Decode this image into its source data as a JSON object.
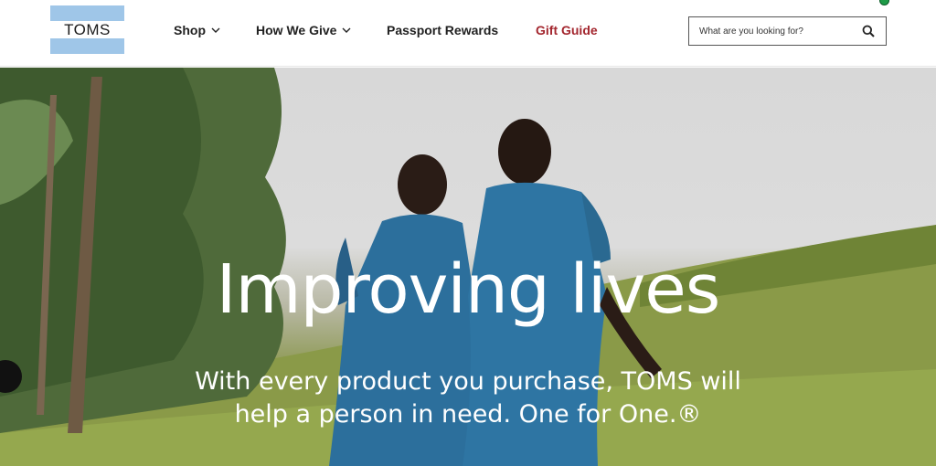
{
  "brand": {
    "logo_text": "TOMS"
  },
  "nav": {
    "shop": "Shop",
    "how_we_give": "How We Give",
    "passport_rewards": "Passport Rewards",
    "gift_guide": "Gift Guide"
  },
  "search": {
    "placeholder": "What are you looking for?"
  },
  "hero": {
    "headline": "Improving lives",
    "subline_1": "With every product you purchase, TOMS will",
    "subline_2": "help a person in need. One for One.®"
  },
  "colors": {
    "logo_blue": "#9fc6e8",
    "gift_guide_red": "#a3262e",
    "cart_badge_green": "#1e9b48"
  }
}
